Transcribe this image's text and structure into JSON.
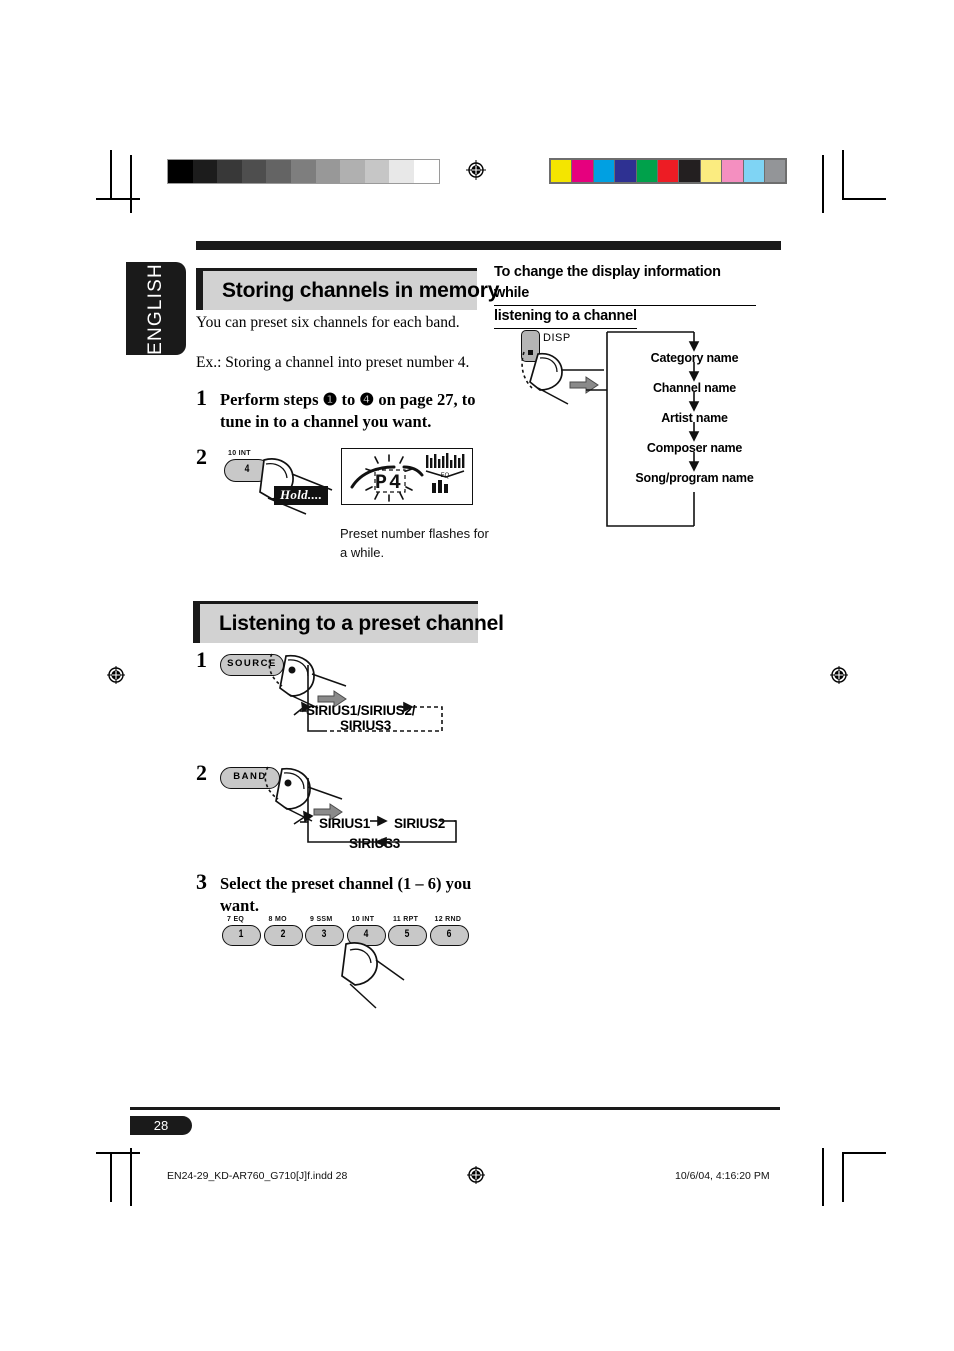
{
  "page": {
    "language_tab": "ENGLISH",
    "number": "28"
  },
  "printer_marks": {
    "grayscale_steps": [
      "#000000",
      "#1c1c1c",
      "#383838",
      "#4e4e4e",
      "#646464",
      "#7e7e7e",
      "#989898",
      "#b0b0b0",
      "#c6c6c6",
      "#e8e8e8",
      "#ffffff"
    ],
    "color_patches": [
      "#f4e500",
      "#e6007e",
      "#00a0e2",
      "#2e3192",
      "#00a14b",
      "#ed1c24",
      "#231f20",
      "#fbec80",
      "#f48fc0",
      "#7fd4f4",
      "#939598"
    ]
  },
  "section1": {
    "title": "Storing channels in memory",
    "intro": "You can preset six channels for each band.",
    "example": "Ex.: Storing a channel into preset number 4.",
    "step1_number": "1",
    "step1_text": "Perform steps ❶ to ❹ on page 27, to tune in to a channel you want.",
    "step2_number": "2",
    "button_label": "4",
    "button_tiny_label": "10 INT",
    "hold_label": "Hold....",
    "lcd_text": "P4",
    "caption": "Preset number flashes for a while."
  },
  "section2": {
    "title": "Listening to a preset channel",
    "step1_number": "1",
    "source_button": "SOURCE",
    "source_sequence_line1": "SIRIUS1/SIRIUS2/",
    "source_sequence_line2": "SIRIUS3",
    "step2_number": "2",
    "band_button": "BAND",
    "band_seq1": "SIRIUS1",
    "band_seq2": "SIRIUS2",
    "band_seq3": "SIRIUS3",
    "step3_number": "3",
    "step3_text": "Select the preset channel (1 – 6) you want.",
    "preset_buttons": [
      {
        "tiny": "7  EQ",
        "num": "1"
      },
      {
        "tiny": "8  MO",
        "num": "2"
      },
      {
        "tiny": "9  SSM",
        "num": "3"
      },
      {
        "tiny": "10 INT",
        "num": "4"
      },
      {
        "tiny": "11 RPT",
        "num": "5"
      },
      {
        "tiny": "12 RND",
        "num": "6"
      }
    ]
  },
  "display_info": {
    "heading_line1": "To change the display information while",
    "heading_line2": "listening to a channel",
    "button": "DISP",
    "items": [
      "Category name",
      "Channel name",
      "Artist name",
      "Composer name",
      "Song/program name"
    ]
  },
  "footer": {
    "file": "EN24-29_KD-AR760_G710[J]f.indd   28",
    "timestamp": "10/6/04, 4:16:20 PM"
  }
}
